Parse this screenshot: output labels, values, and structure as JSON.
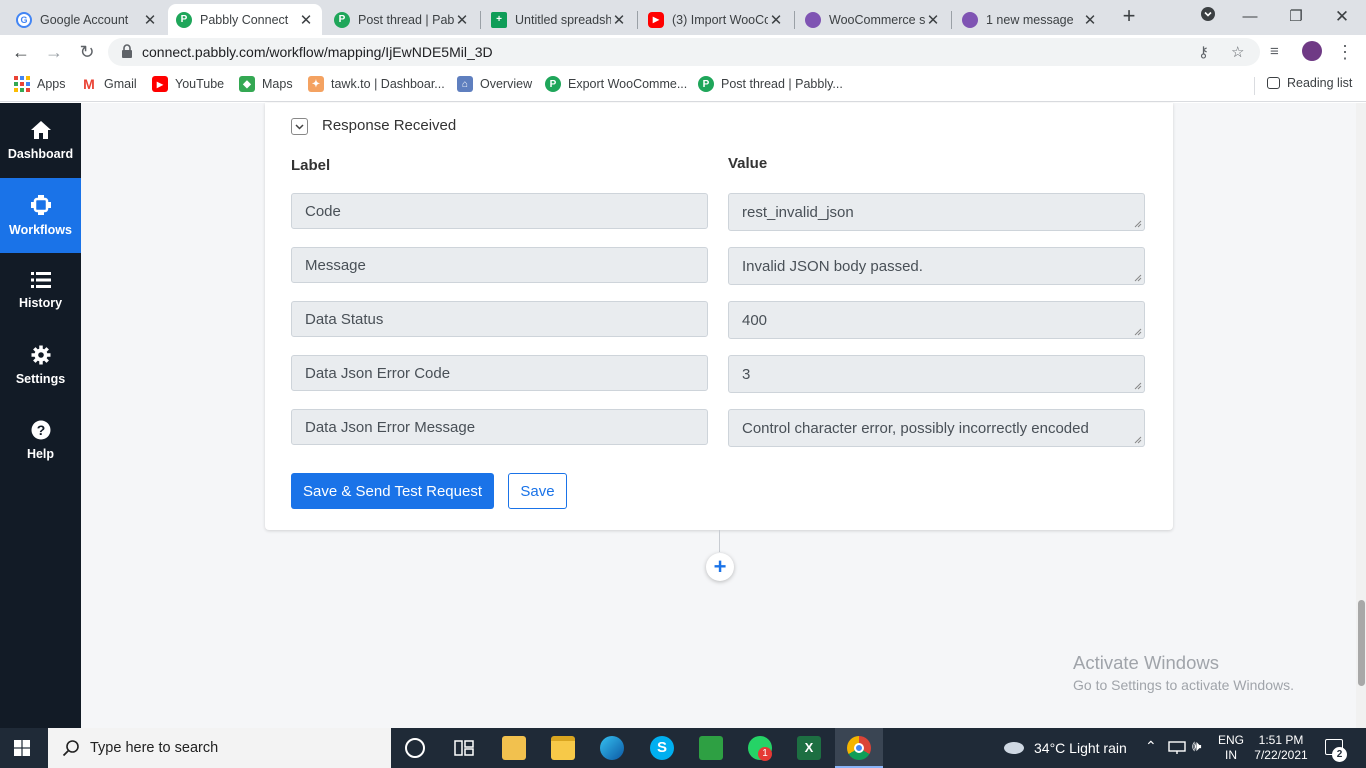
{
  "browser": {
    "tabs": [
      {
        "title": "Google Account",
        "icon": "google-icon",
        "color": "#4285f4",
        "active": false
      },
      {
        "title": "Pabbly Connect",
        "icon": "pabbly-icon",
        "color": "#1fa65a",
        "active": true
      },
      {
        "title": "Post thread | Pabl",
        "icon": "pabbly-icon",
        "color": "#1fa65a",
        "active": false
      },
      {
        "title": "Untitled spreadsh",
        "icon": "sheets-icon",
        "color": "#0f9d58",
        "active": false
      },
      {
        "title": "(3) Import WooCo",
        "icon": "youtube-icon",
        "color": "#ff0000",
        "active": false
      },
      {
        "title": "WooCommerce s",
        "icon": "woocommerce-icon",
        "color": "#7f54b3",
        "active": false
      },
      {
        "title": "1 new message",
        "icon": "woocommerce-icon",
        "color": "#7f54b3",
        "active": false
      }
    ],
    "url": "connect.pabbly.com/workflow/mapping/IjEwNDE5Mil_3D",
    "bookmarks": [
      {
        "label": "Apps",
        "icon": "apps-grid-icon"
      },
      {
        "label": "Gmail",
        "icon": "gmail-icon"
      },
      {
        "label": "YouTube",
        "icon": "youtube-icon"
      },
      {
        "label": "Maps",
        "icon": "maps-icon"
      },
      {
        "label": "tawk.to | Dashboar...",
        "icon": "tawkto-icon"
      },
      {
        "label": "Overview",
        "icon": "overview-icon"
      },
      {
        "label": "Export WooComme...",
        "icon": "pabbly-icon"
      },
      {
        "label": "Post thread | Pabbly...",
        "icon": "pabbly-icon"
      }
    ],
    "reading_list": "Reading list"
  },
  "sidebar": {
    "items": [
      {
        "label": "Dashboard",
        "icon": "home-icon",
        "active": false
      },
      {
        "label": "Workflows",
        "icon": "workflow-icon",
        "active": true
      },
      {
        "label": "History",
        "icon": "list-icon",
        "active": false
      },
      {
        "label": "Settings",
        "icon": "gear-icon",
        "active": false
      },
      {
        "label": "Help",
        "icon": "help-icon",
        "active": false
      }
    ]
  },
  "response": {
    "title": "Response Received",
    "label_header": "Label",
    "value_header": "Value",
    "rows": [
      {
        "label": "Code",
        "value": "rest_invalid_json"
      },
      {
        "label": "Message",
        "value": "Invalid JSON body passed."
      },
      {
        "label": "Data Status",
        "value": "400"
      },
      {
        "label": "Data Json Error Code",
        "value": "3"
      },
      {
        "label": "Data Json Error Message",
        "value": "Control character error, possibly incorrectly encoded"
      }
    ],
    "save_send_label": "Save & Send Test Request",
    "save_label": "Save",
    "add_step_symbol": "+"
  },
  "watermark": {
    "line1": "Activate Windows",
    "line2": "Go to Settings to activate Windows."
  },
  "taskbar": {
    "search_placeholder": "Type here to search",
    "weather": "34°C  Light rain",
    "lang_top": "ENG",
    "lang_bottom": "IN",
    "time": "1:51 PM",
    "date": "7/22/2021",
    "notifications": "2",
    "whatsapp_badge": "1"
  },
  "colors": {
    "accent": "#1a73e8",
    "sidebar_bg": "#121b26",
    "taskbar_bg": "#1f2a37"
  }
}
